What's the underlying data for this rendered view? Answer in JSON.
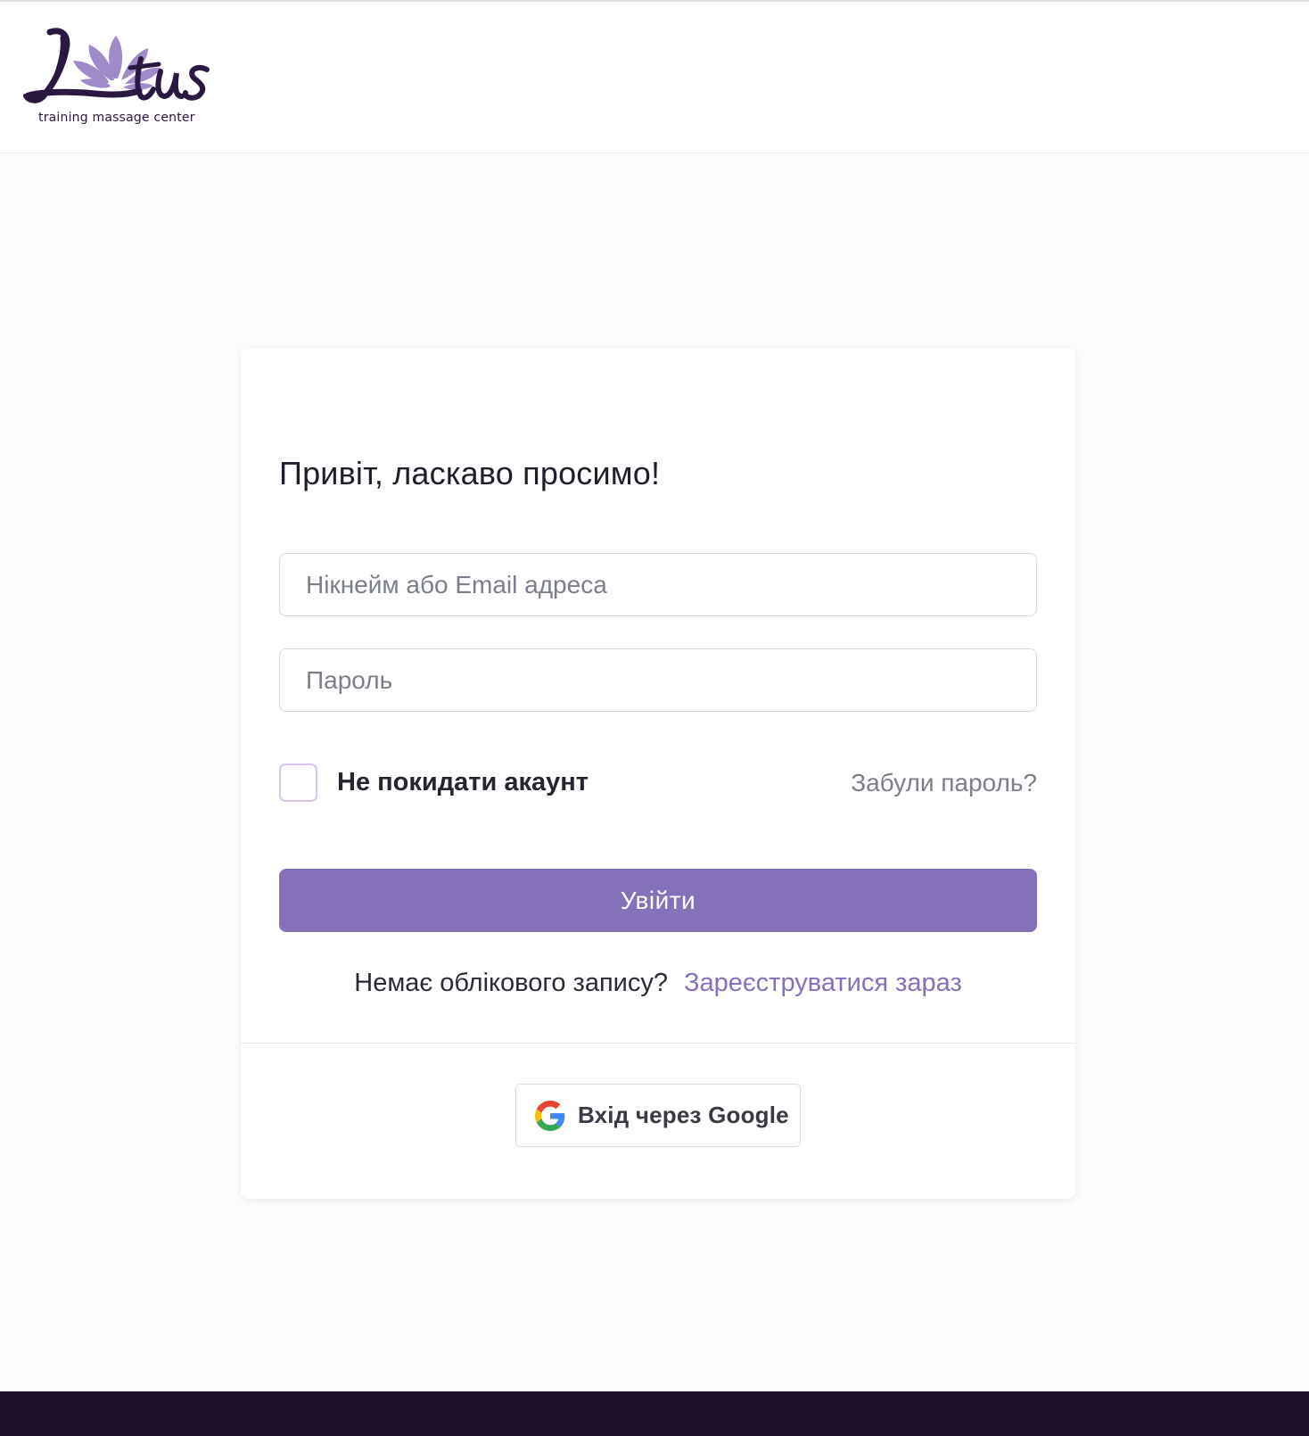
{
  "brand": {
    "name": "Lotus",
    "tagline": "training massage center"
  },
  "login": {
    "title": "Привіт, ласкаво просимо!",
    "login_placeholder": "Нікнейм або Email адреса",
    "password_placeholder": "Пароль",
    "remember_label": "Не покидати акаунт",
    "remember_checked": false,
    "forgot_link": "Забули пароль?",
    "submit_label": "Увійти",
    "register_prompt": "Немає облікового запису?",
    "register_link": "Зареєструватися зараз",
    "google_label": "Вхід через Google"
  },
  "colors": {
    "accent": "#8571b9",
    "footer": "#1d112c",
    "logo_dark": "#2b1840",
    "logo_petal": "#9a84c8"
  },
  "icons": {
    "logo": "lotus-flower-logo",
    "google": "google-g-icon"
  }
}
